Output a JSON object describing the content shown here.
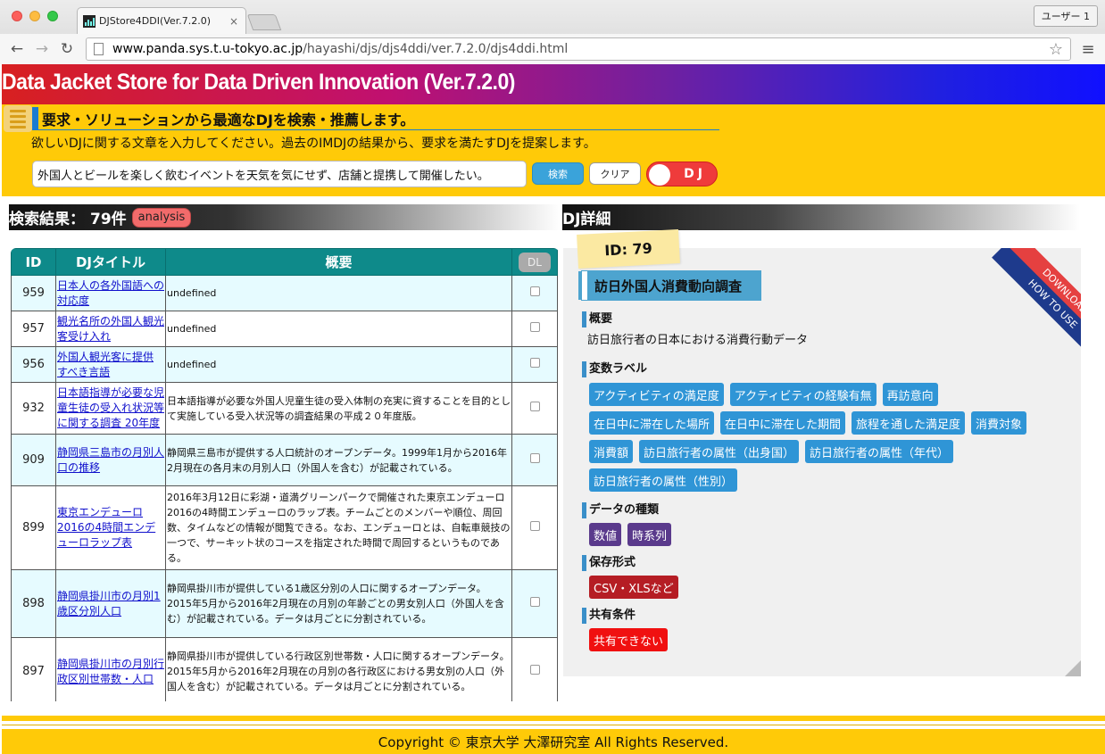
{
  "browser": {
    "tab_title": "DJStore4DDI(Ver.7.2.0)",
    "tab_close": "×",
    "user_button": "ユーザー 1",
    "url_host": "www.panda.sys.t.u-tokyo.ac.jp",
    "url_path": "/hayashi/djs/djs4ddi/ver.7.2.0/djs4ddi.html",
    "back": "←",
    "forward": "→",
    "reload": "↻",
    "star": "☆",
    "menu": "≡"
  },
  "header": {
    "title": "Data Jacket Store for Data Driven Innovation (Ver.7.2.0)",
    "headline": "要求・ソリューションから最適なDJを検索・推薦します。",
    "subline": "欲しいDJに関する文章を入力してください。過去のIMDJの結果から、要求を満たすDJを提案します。",
    "search_value": "外国人とビールを楽しく飲むイベントを天気を気にせず、店舗と提携して開催したい。",
    "search_button": "検索",
    "clear_button": "クリア",
    "toggle_label": "DJ"
  },
  "results": {
    "heading": "検索結果：",
    "count": "79件",
    "analysis_button": "analysis",
    "columns": {
      "id": "ID",
      "title": "DJタイトル",
      "summary": "概要",
      "dl": "DL"
    },
    "rows": [
      {
        "id": "959",
        "title": "日本人の各外国語への対応度",
        "summary": "undefined"
      },
      {
        "id": "957",
        "title": "観光名所の外国人観光客受け入れ",
        "summary": "undefined"
      },
      {
        "id": "956",
        "title": "外国人観光客に提供すべき言語",
        "summary": "undefined"
      },
      {
        "id": "932",
        "title": "日本語指導が必要な児童生徒の受入れ状況等に関する調査 20年度",
        "summary": "日本語指導が必要な外国人児童生徒の受入体制の充実に資することを目的として実施している受入状況等の調査結果の平成２０年度版。"
      },
      {
        "id": "909",
        "title": "静岡県三島市の月別人口の推移",
        "summary": "静岡県三島市が提供する人口統計のオープンデータ。1999年1月から2016年2月現在の各月末の月別人口（外国人を含む）が記載されている。"
      },
      {
        "id": "899",
        "title": "東京エンデューロ2016の4時間エンデューロラップ表",
        "summary": "2016年3月12日に彩湖・道満グリーンパークで開催された東京エンデューロ2016の4時間エンデューロのラップ表。チームごとのメンバーや順位、周回数、タイムなどの情報が閲覧できる。なお、エンデューロとは、自転車競技の一つで、サーキット状のコースを指定された時間で周回するというものである。"
      },
      {
        "id": "898",
        "title": "静岡県掛川市の月別1歳区分別人口",
        "summary": "静岡県掛川市が提供している1歳区分別の人口に関するオープンデータ。2015年5月から2016年2月現在の月別の年齢ごとの男女別人口（外国人を含む）が記載されている。データは月ごとに分割されている。"
      },
      {
        "id": "897",
        "title": "静岡県掛川市の月別行政区別世帯数・人口",
        "summary": "静岡県掛川市が提供している行政区別世帯数・人口に関するオープンデータ。2015年5月から2016年2月現在の月別の各行政区における男女別の人口（外国人を含む）が記載されている。データは月ごとに分割されている。"
      }
    ]
  },
  "detail": {
    "heading": "DJ詳細",
    "id_label": "ID: 79",
    "ribbon_download": "DOWNLOAD",
    "ribbon_howto": "HOW TO USE",
    "title": "訪日外国人消費動向調査",
    "summary_label": "概要",
    "summary": "訪日旅行者の日本における消費行動データ",
    "variables_label": "変数ラベル",
    "variables": [
      "アクティビティの満足度",
      "アクティビティの経験有無",
      "再訪意向",
      "在日中に滞在した場所",
      "在日中に滞在した期間",
      "旅程を通した満足度",
      "消費対象",
      "消費額",
      "訪日旅行者の属性（出身国）",
      "訪日旅行者の属性（年代）",
      "訪日旅行者の属性（性別）"
    ],
    "datatype_label": "データの種類",
    "datatypes": [
      "数値",
      "時系列"
    ],
    "format_label": "保存形式",
    "format": "CSV・XLSなど",
    "share_label": "共有条件",
    "share": "共有できない"
  },
  "footer": {
    "copyright": "Copyright © 東京大学 大澤研究室 All Rights Reserved."
  },
  "colors": {
    "banner_start": "#d82020",
    "banner_end": "#1010ff",
    "yellow": "#ffca08",
    "table_header": "#0e8a8a",
    "tag_blue": "#2f95d6",
    "tag_purple": "#5a3a8c",
    "tag_darkred": "#b51d24",
    "tag_red": "#f01010"
  }
}
